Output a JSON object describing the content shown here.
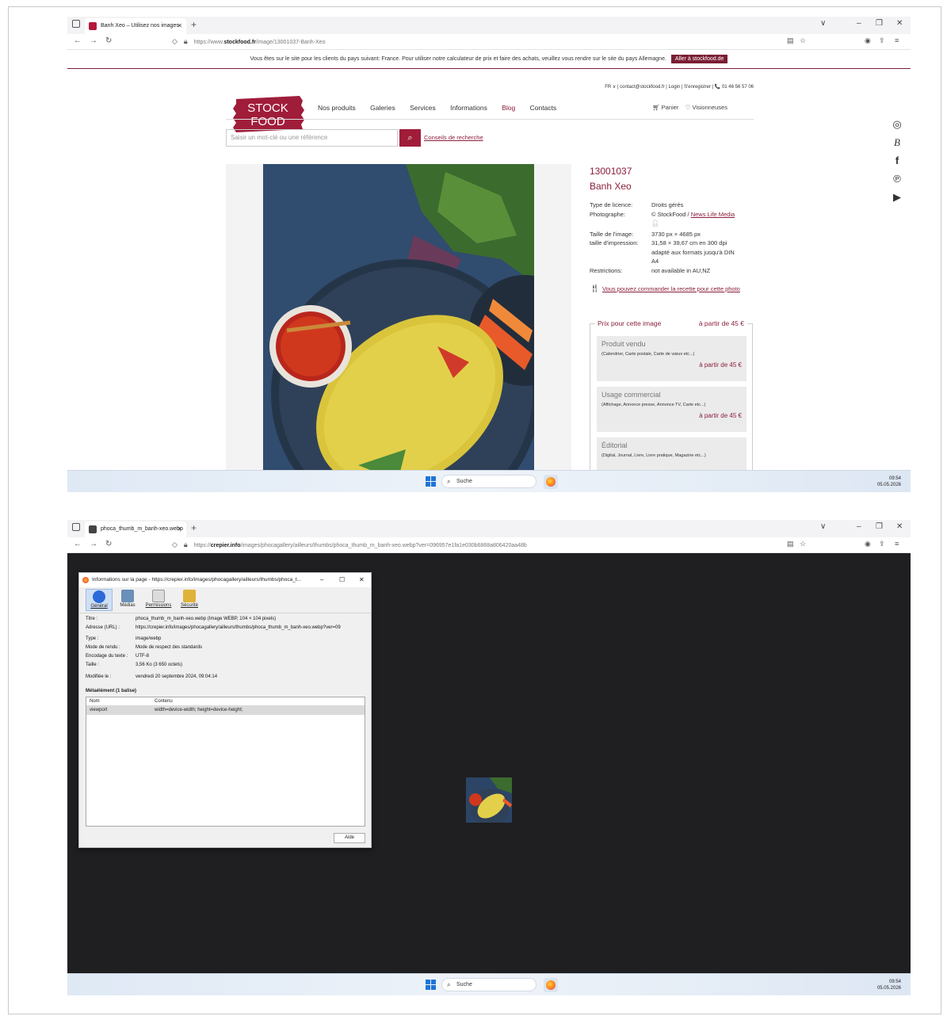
{
  "shot1": {
    "tab_title": "Banh Xeo – Utilisez nos images",
    "url_prefix": "https://www.",
    "url_host": "stockfood.fr",
    "url_path": "/image/13001037-Banh-Xeo",
    "banner_text": "Vous êtes sur le site pour les clients du pays suivant: France. Pour utiliser notre calculateur de prix et faire des achats, veuillez vous rendre sur le site du pays Allemagne.",
    "banner_cta": "Aller à stockfood.de",
    "top_info": "FR ∨ | contact@stockfood.fr | Login | S'enregistrer | 📞 01 46 56 57 06",
    "logo_line1": "STOCK",
    "logo_line2": "FOOD",
    "nav": {
      "produits": "Nos produits",
      "galeries": "Galeries",
      "services": "Services",
      "informations": "Informations",
      "blog": "Blog",
      "contacts": "Contacts"
    },
    "cart": "Panier",
    "viewers": "Visionneuses",
    "search_placeholder": "Saisir un mot-clé ou une référence",
    "search_tips": "Conseils de recherche",
    "image_id": "13001037",
    "image_title": "Banh Xeo",
    "details": {
      "license_k": "Type de licence:",
      "license_v": "Droits gérés",
      "photographer_k": "Photographe:",
      "photographer_v": "© StockFood / ",
      "photographer_link": "News Life Media",
      "size_k": "Taille de l'image:",
      "size_v": "3730 px × 4685 px",
      "print_k": "taille d'impression:",
      "print_v1": "31,58 × 39,67 cm en 300 dpi",
      "print_v2": "adapté aux formats jusqu'à DIN",
      "print_v3": "A4",
      "restrictions_k": "Restrictions:",
      "restrictions_v": "not available in AU,NZ"
    },
    "recipe_link": "Vous pouvez commander la recette pour cette photo",
    "price_header": "Prix pour cette image",
    "price_from": "à partir de 45 €",
    "cards": [
      {
        "title": "Produit vendu",
        "sub": "(Calendrier, Carte postale, Carte de vœux etc...)",
        "price": "à partir de 45 €"
      },
      {
        "title": "Usage commercial",
        "sub": "(Affichage, Annonce presse, Annonce TV, Carte etc...)",
        "price": "à partir de 45 €"
      },
      {
        "title": "Éditorial",
        "sub": "(Digital, Journal, Livre, Livre pratique, Magazine etc...)"
      }
    ],
    "taskbar_search": "Suche",
    "clock_time": "09:54",
    "clock_date": "05.05.2026"
  },
  "shot2": {
    "tab_title": "phoca_thumb_m_banh-xeo.webp",
    "url_prefix": "https://",
    "url_host": "crepier.info",
    "url_path": "/images/phocagallery/ailleurs/thumbs/phoca_thumb_m_banh-xeo.webp?ver=096957e1fa1e030b6868a806420aa48b",
    "dialog_title": "Informations sur la page - https://crepier.info/images/phocagallery/ailleurs/thumbs/phoca_t...",
    "tabs": [
      "Général",
      "Médias",
      "Permissions",
      "Sécurité"
    ],
    "fields": {
      "titre_k": "Titre :",
      "titre_v": "phoca_thumb_m_banh-xeo.webp (Image WEBP, 104 × 104 pixels)",
      "adresse_k": "Adresse (URL) :",
      "adresse_v": "https://crepier.info/images/phocagallery/ailleurs/thumbs/phoca_thumb_m_banh-xeo.webp?ver=09",
      "type_k": "Type :",
      "type_v": "image/webp",
      "rendu_k": "Mode de rendu :",
      "rendu_v": "Mode de respect des standards",
      "encodage_k": "Encodage du texte :",
      "encodage_v": "UTF-8",
      "taille_k": "Taille :",
      "taille_v": "3,56 Ko (3 650 octets)",
      "modifiee_k": "Modifiée le :",
      "modifiee_v": "vendredi 20 septembre 2024, 09:04:14"
    },
    "meta_heading": "Métaélément (1 balise)",
    "meta_col_name": "Nom",
    "meta_col_content": "Contenu",
    "meta_row_name": "viewport",
    "meta_row_content": "width=device-width; height=device-height;",
    "help_button": "Aide",
    "taskbar_search": "Suche",
    "clock_time": "09:54",
    "clock_date": "05.05.2026"
  },
  "colors": {
    "brand": "#8a1f3b",
    "dark_bg": "#1f1f22"
  }
}
